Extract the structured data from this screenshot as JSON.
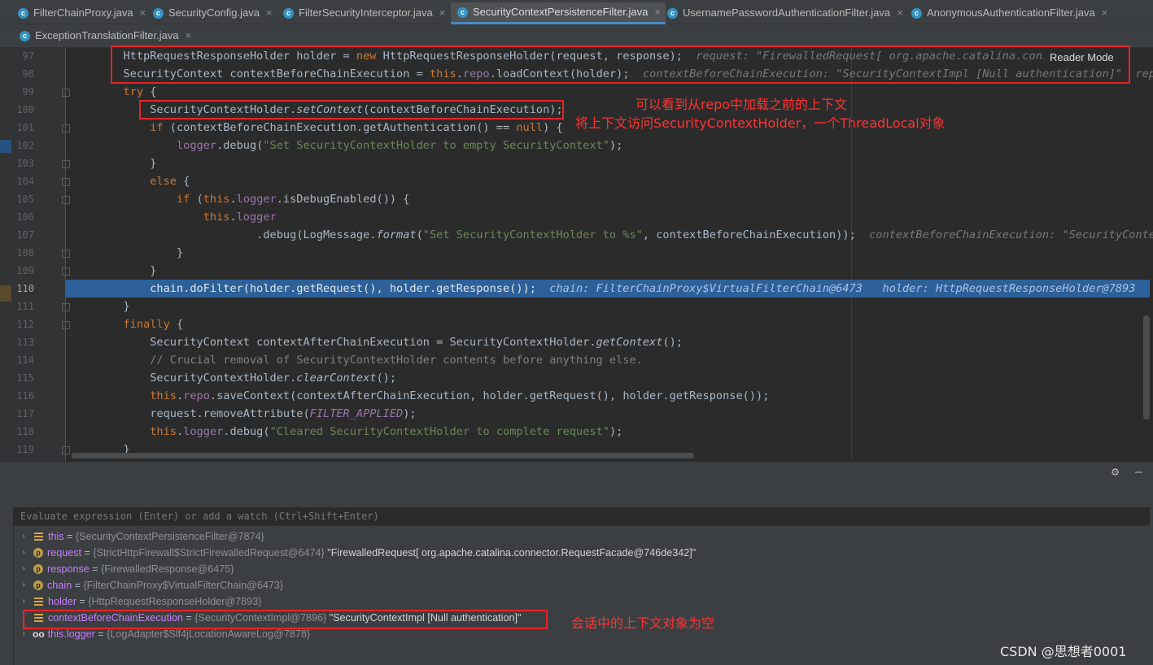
{
  "tabs": {
    "row1": [
      {
        "label": "FilterChainProxy.java"
      },
      {
        "label": "SecurityConfig.java"
      },
      {
        "label": "FilterSecurityInterceptor.java"
      },
      {
        "label": "SecurityContextPersistenceFilter.java"
      },
      {
        "label": "UsernamePasswordAuthenticationFilter.java"
      },
      {
        "label": "AnonymousAuthenticationFilter.java"
      }
    ],
    "row2": [
      {
        "label": "ExceptionTranslationFilter.java"
      }
    ],
    "active_index": 3,
    "class_icon_letter": "c",
    "close_symbol": "×"
  },
  "editor": {
    "reader_mode": "Reader Mode",
    "line_numbers": [
      "97",
      "98",
      "99",
      "100",
      "101",
      "102",
      "103",
      "104",
      "105",
      "106",
      "107",
      "108",
      "109",
      "110",
      "111",
      "112",
      "113",
      "114",
      "115",
      "116",
      "117",
      "118",
      "119"
    ],
    "current_line": "110",
    "inline_hints": {
      "l97": "request: \"FirewalledRequest[ org.apache.catalina.conn",
      "l98": "contextBeforeChainExecution: \"SecurityContextImpl [Null authentication]\"",
      "l98b": "repo",
      "l107": "contextBeforeChainExecution: \"SecurityContextI",
      "l110a": "chain: FilterChainProxy$VirtualFilterChain@6473",
      "l110b": "holder: HttpRequestResponseHolder@7893"
    },
    "annotations": {
      "a1": "可以看到从repo中加载之前的上下文",
      "a2": "将上下文访问SecurityContextHolder，一个ThreadLocal对象"
    },
    "colors": {
      "keyword": "#cc7832",
      "string": "#6a8759",
      "field": "#9876aa",
      "highlight": "#2d6099",
      "annotation": "#e5252a"
    }
  },
  "debugger": {
    "evaluate_placeholder": "Evaluate expression (Enter) or add a watch (Ctrl+Shift+Enter)",
    "variables": [
      {
        "icon": "field",
        "name": "this",
        "eq": " = ",
        "value": "{SecurityContextPersistenceFilter@7874}",
        "str": ""
      },
      {
        "icon": "param",
        "name": "request",
        "eq": " = ",
        "value": "{StrictHttpFirewall$StrictFirewalledRequest@6474}",
        "str": "\"FirewalledRequest[ org.apache.catalina.connector.RequestFacade@746de342]\""
      },
      {
        "icon": "param",
        "name": "response",
        "eq": " = ",
        "value": "{FirewalledResponse@6475}",
        "str": ""
      },
      {
        "icon": "param",
        "name": "chain",
        "eq": " = ",
        "value": "{FilterChainProxy$VirtualFilterChain@6473}",
        "str": ""
      },
      {
        "icon": "field",
        "name": "holder",
        "eq": " = ",
        "value": "{HttpRequestResponseHolder@7893}",
        "str": ""
      },
      {
        "icon": "field",
        "name": "contextBeforeChainExecution",
        "eq": " = ",
        "value": "{SecurityContextImpl@7896}",
        "str": "\"SecurityContextImpl [Null authentication]\""
      },
      {
        "icon": "watch",
        "name": "this.logger",
        "eq": " = ",
        "value": "{LogAdapter$Slf4jLocationAwareLog@7878}",
        "str": ""
      }
    ],
    "param_icon_letter": "p",
    "watch_icon": "oo",
    "expand_icon": "›",
    "annotation": "会话中的上下文对象为空",
    "gear": "⚙",
    "minus": "–"
  },
  "watermark": "CSDN @思想者0001"
}
